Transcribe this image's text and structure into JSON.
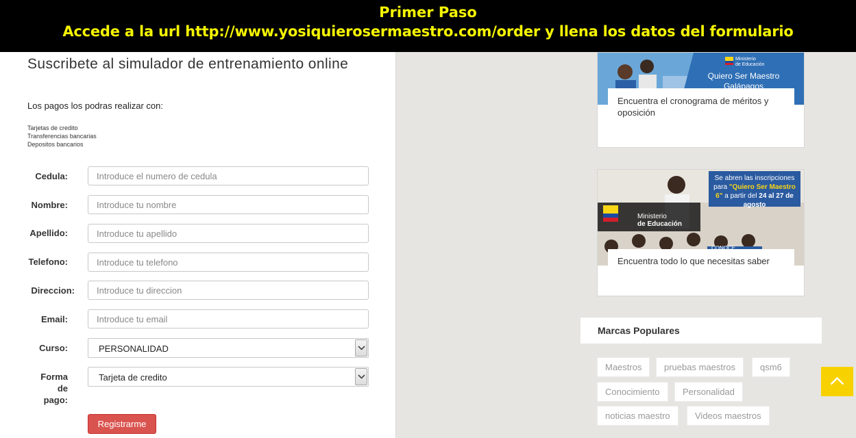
{
  "banner": {
    "line1": "Primer Paso",
    "line2": "Accede a la url http://www.yosiquierosermaestro.com/order y llena los datos del formulario"
  },
  "form": {
    "title": "Suscribete al simulador de entrenamiento online",
    "payments_intro": "Los pagos los podras realizar con:",
    "payment_methods": [
      "Tarjetas de credito",
      "Transferencias bancarias",
      "Depositos bancarios"
    ],
    "fields": [
      {
        "label": "Cedula:",
        "placeholder": "Introduce el numero de cedula",
        "value": ""
      },
      {
        "label": "Nombre:",
        "placeholder": "Introduce tu nombre",
        "value": ""
      },
      {
        "label": "Apellido:",
        "placeholder": "Introduce tu apellido",
        "value": ""
      },
      {
        "label": "Telefono:",
        "placeholder": "Introduce tu telefono",
        "value": ""
      },
      {
        "label": "Direccion:",
        "placeholder": "Introduce tu direccion",
        "value": ""
      },
      {
        "label": "Email:",
        "placeholder": "Introduce tu email",
        "value": ""
      }
    ],
    "curso": {
      "label": "Curso:",
      "selected": "PERSONALIDAD"
    },
    "forma_pago": {
      "label_lines": [
        "Forma",
        "de",
        "pago:"
      ],
      "selected": "Tarjeta de credito"
    },
    "submit_label": "Registrarme"
  },
  "sidebar": {
    "cards": [
      {
        "caption": "Encuentra el cronograma de méritos y oposición",
        "image_text": {
          "ministry_line1": "Ministerio",
          "ministry_line2": "de Educación",
          "headline1": "Quiero Ser Maestro",
          "headline2": "Galápagos"
        }
      },
      {
        "caption": "Encuentra todo lo que necesitas saber",
        "image_text": {
          "notice_line1": "Se abren las inscripciones",
          "notice_line2_a": "para ",
          "notice_line2_b": "\"Quiero Ser Maestro",
          "notice_line3_a": "6\"",
          "notice_line3_b": " a partir del ",
          "notice_line3_c": "24 al 27 de",
          "notice_line4": "agosto",
          "ministry_line1": "Ministerio",
          "ministry_line2": "de Educación",
          "ribbon": "CONOCE"
        }
      }
    ],
    "popular_title": "Marcas Populares",
    "tags": [
      "Maestros",
      "pruebas maestros",
      "qsm6",
      "Conocimiento",
      "Personalidad",
      "noticias maestro",
      "Videos maestros"
    ]
  },
  "colors": {
    "banner_bg": "#000000",
    "banner_text": "#f5f500",
    "register_button": "#d9534f",
    "back_to_top": "#f8d200",
    "page_bg": "#e6e5e1"
  },
  "icons": {
    "select_arrow": "chevron-down-icon",
    "back_to_top": "chevron-up-icon"
  }
}
